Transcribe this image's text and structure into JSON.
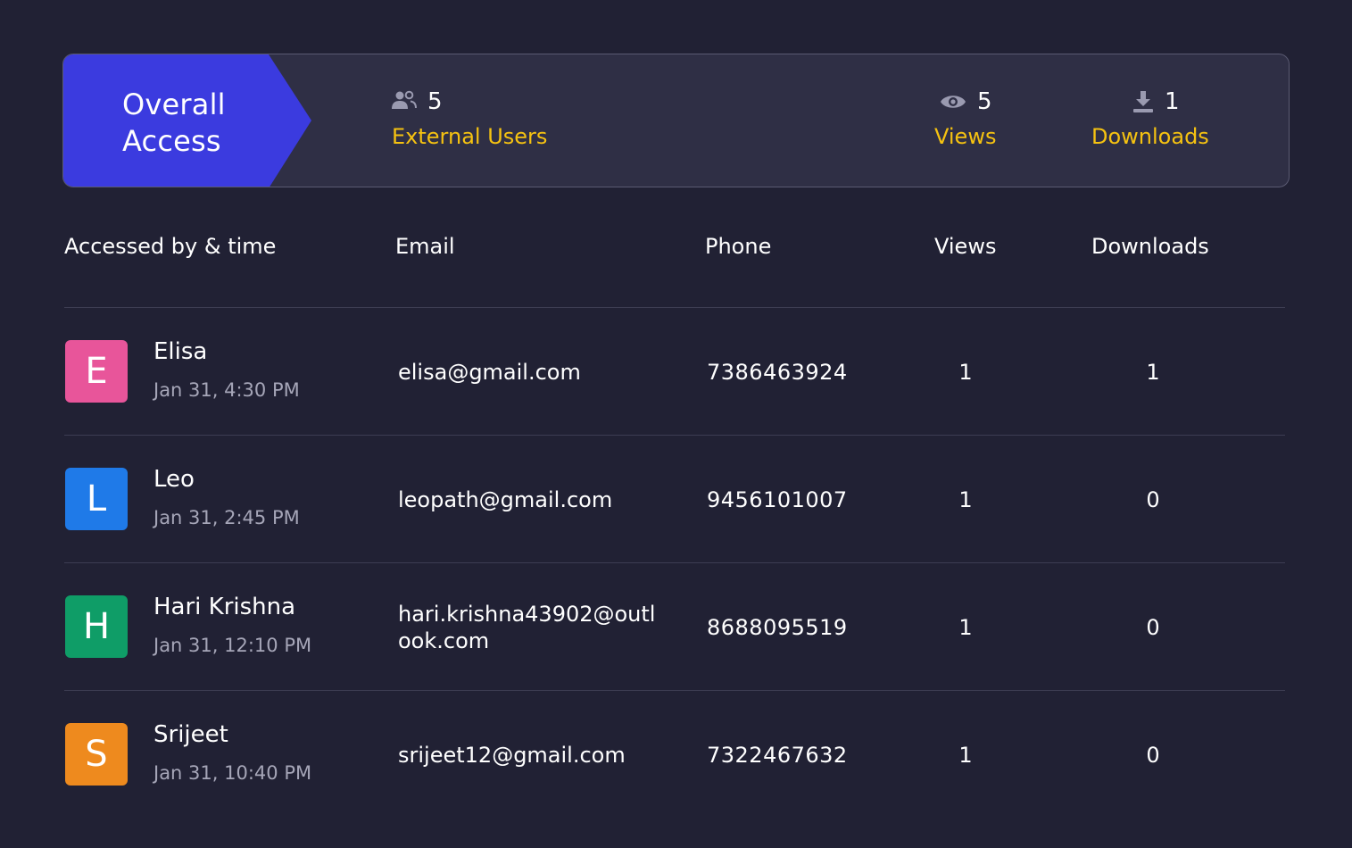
{
  "summary": {
    "title": "Overall Access",
    "title_bg_color": "#3b3bdf",
    "label_color": "#f5c211",
    "stats": [
      {
        "icon": "users-icon",
        "count": "5",
        "label": "External Users"
      },
      {
        "icon": "eye-icon",
        "count": "5",
        "label": "Views"
      },
      {
        "icon": "download-icon",
        "count": "1",
        "label": "Downloads"
      }
    ]
  },
  "table": {
    "columns": [
      "Accessed by & time",
      "Email",
      "Phone",
      "Views",
      "Downloads"
    ],
    "rows": [
      {
        "initial": "E",
        "avatar_color": "#e8559a",
        "name": "Elisa",
        "time": "Jan 31, 4:30 PM",
        "email": "elisa@gmail.com",
        "phone": "7386463924",
        "views": "1",
        "downloads": "1"
      },
      {
        "initial": "L",
        "avatar_color": "#1f7ae8",
        "name": "Leo",
        "time": "Jan 31, 2:45 PM",
        "email": "leopath@gmail.com",
        "phone": "9456101007",
        "views": "1",
        "downloads": "0"
      },
      {
        "initial": "H",
        "avatar_color": "#0f9d67",
        "name": "Hari Krishna",
        "time": "Jan 31, 12:10 PM",
        "email": "hari.krishna43902@outlook.com",
        "phone": "8688095519",
        "views": "1",
        "downloads": "0"
      },
      {
        "initial": "S",
        "avatar_color": "#ee8a1e",
        "name": "Srijeet",
        "time": "Jan 31, 10:40 PM",
        "email": "srijeet12@gmail.com",
        "phone": "7322467632",
        "views": "1",
        "downloads": "0"
      }
    ]
  }
}
